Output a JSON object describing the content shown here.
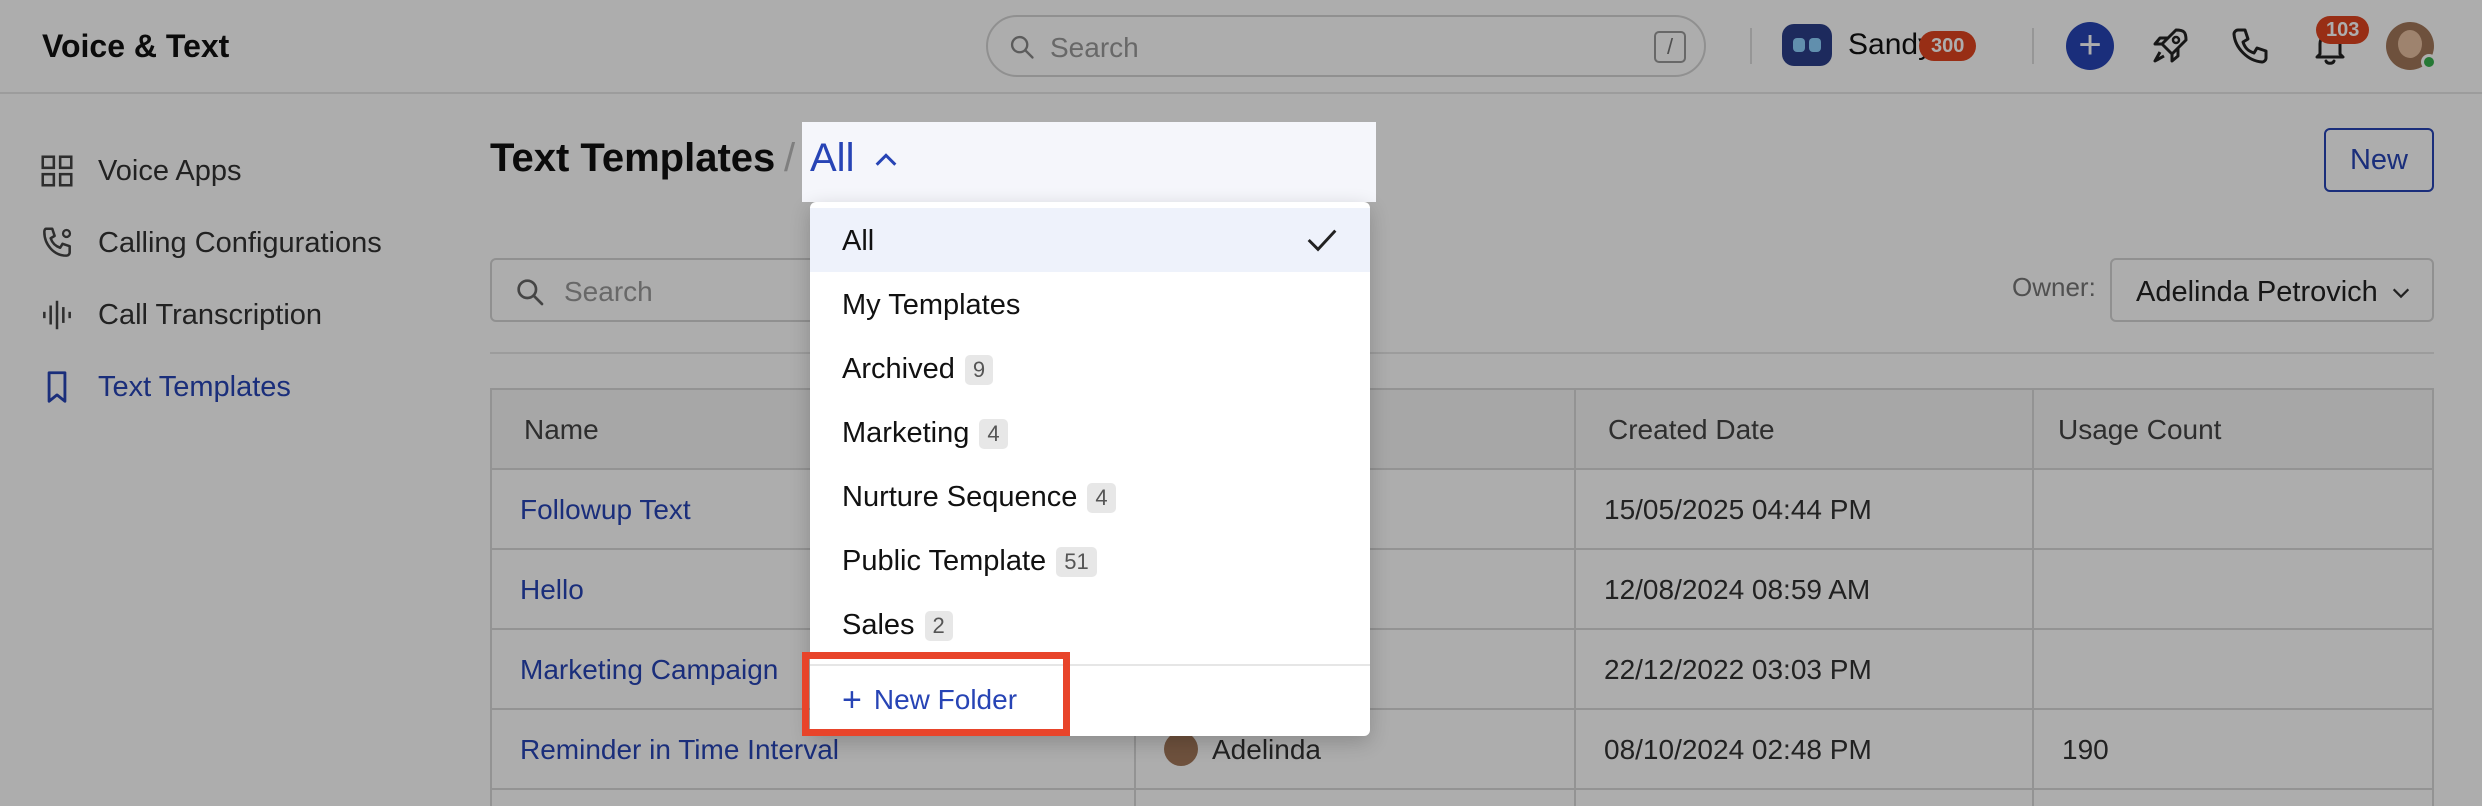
{
  "header": {
    "app_title": "Voice & Text",
    "search_placeholder": "Search",
    "search_shortcut": "/",
    "user_name": "Sandy",
    "credits": "300",
    "notifications": "103"
  },
  "sidebar": {
    "items": [
      {
        "label": "Voice Apps",
        "icon": "grid-icon"
      },
      {
        "label": "Calling Configurations",
        "icon": "phone-settings-icon"
      },
      {
        "label": "Call Transcription",
        "icon": "waveform-icon"
      },
      {
        "label": "Text Templates",
        "icon": "bookmark-icon",
        "active": true
      }
    ]
  },
  "page": {
    "title": "Text Templates",
    "new_button": "New",
    "search_placeholder": "Search",
    "owner_label": "Owner:",
    "owner_value": "Adelinda Petrovich"
  },
  "table": {
    "columns": [
      "Name",
      "Created Date",
      "Usage Count"
    ],
    "rows": [
      {
        "name": "Followup Text",
        "owner": "",
        "created": "15/05/2025 04:44 PM",
        "usage": ""
      },
      {
        "name": "Hello",
        "owner": "",
        "created": "12/08/2024 08:59 AM",
        "usage": ""
      },
      {
        "name": "Marketing Campaign",
        "owner": "",
        "created": "22/12/2022 03:03 PM",
        "usage": ""
      },
      {
        "name": "Reminder in Time Interval",
        "owner": "Adelinda",
        "created": "08/10/2024 02:48 PM",
        "usage": "190"
      }
    ]
  },
  "folder_dropdown": {
    "selected": "All",
    "items": [
      {
        "label": "All",
        "count": "",
        "selected": true
      },
      {
        "label": "My Templates",
        "count": ""
      },
      {
        "label": "Archived",
        "count": "9"
      },
      {
        "label": "Marketing",
        "count": "4"
      },
      {
        "label": "Nurture Sequence",
        "count": "4"
      },
      {
        "label": "Public Template",
        "count": "51"
      },
      {
        "label": "Sales",
        "count": "2"
      }
    ],
    "new_folder_label": "New Folder"
  },
  "colors": {
    "accent": "#2744b5",
    "badge": "#e0451f",
    "highlight": "#e8442a"
  }
}
